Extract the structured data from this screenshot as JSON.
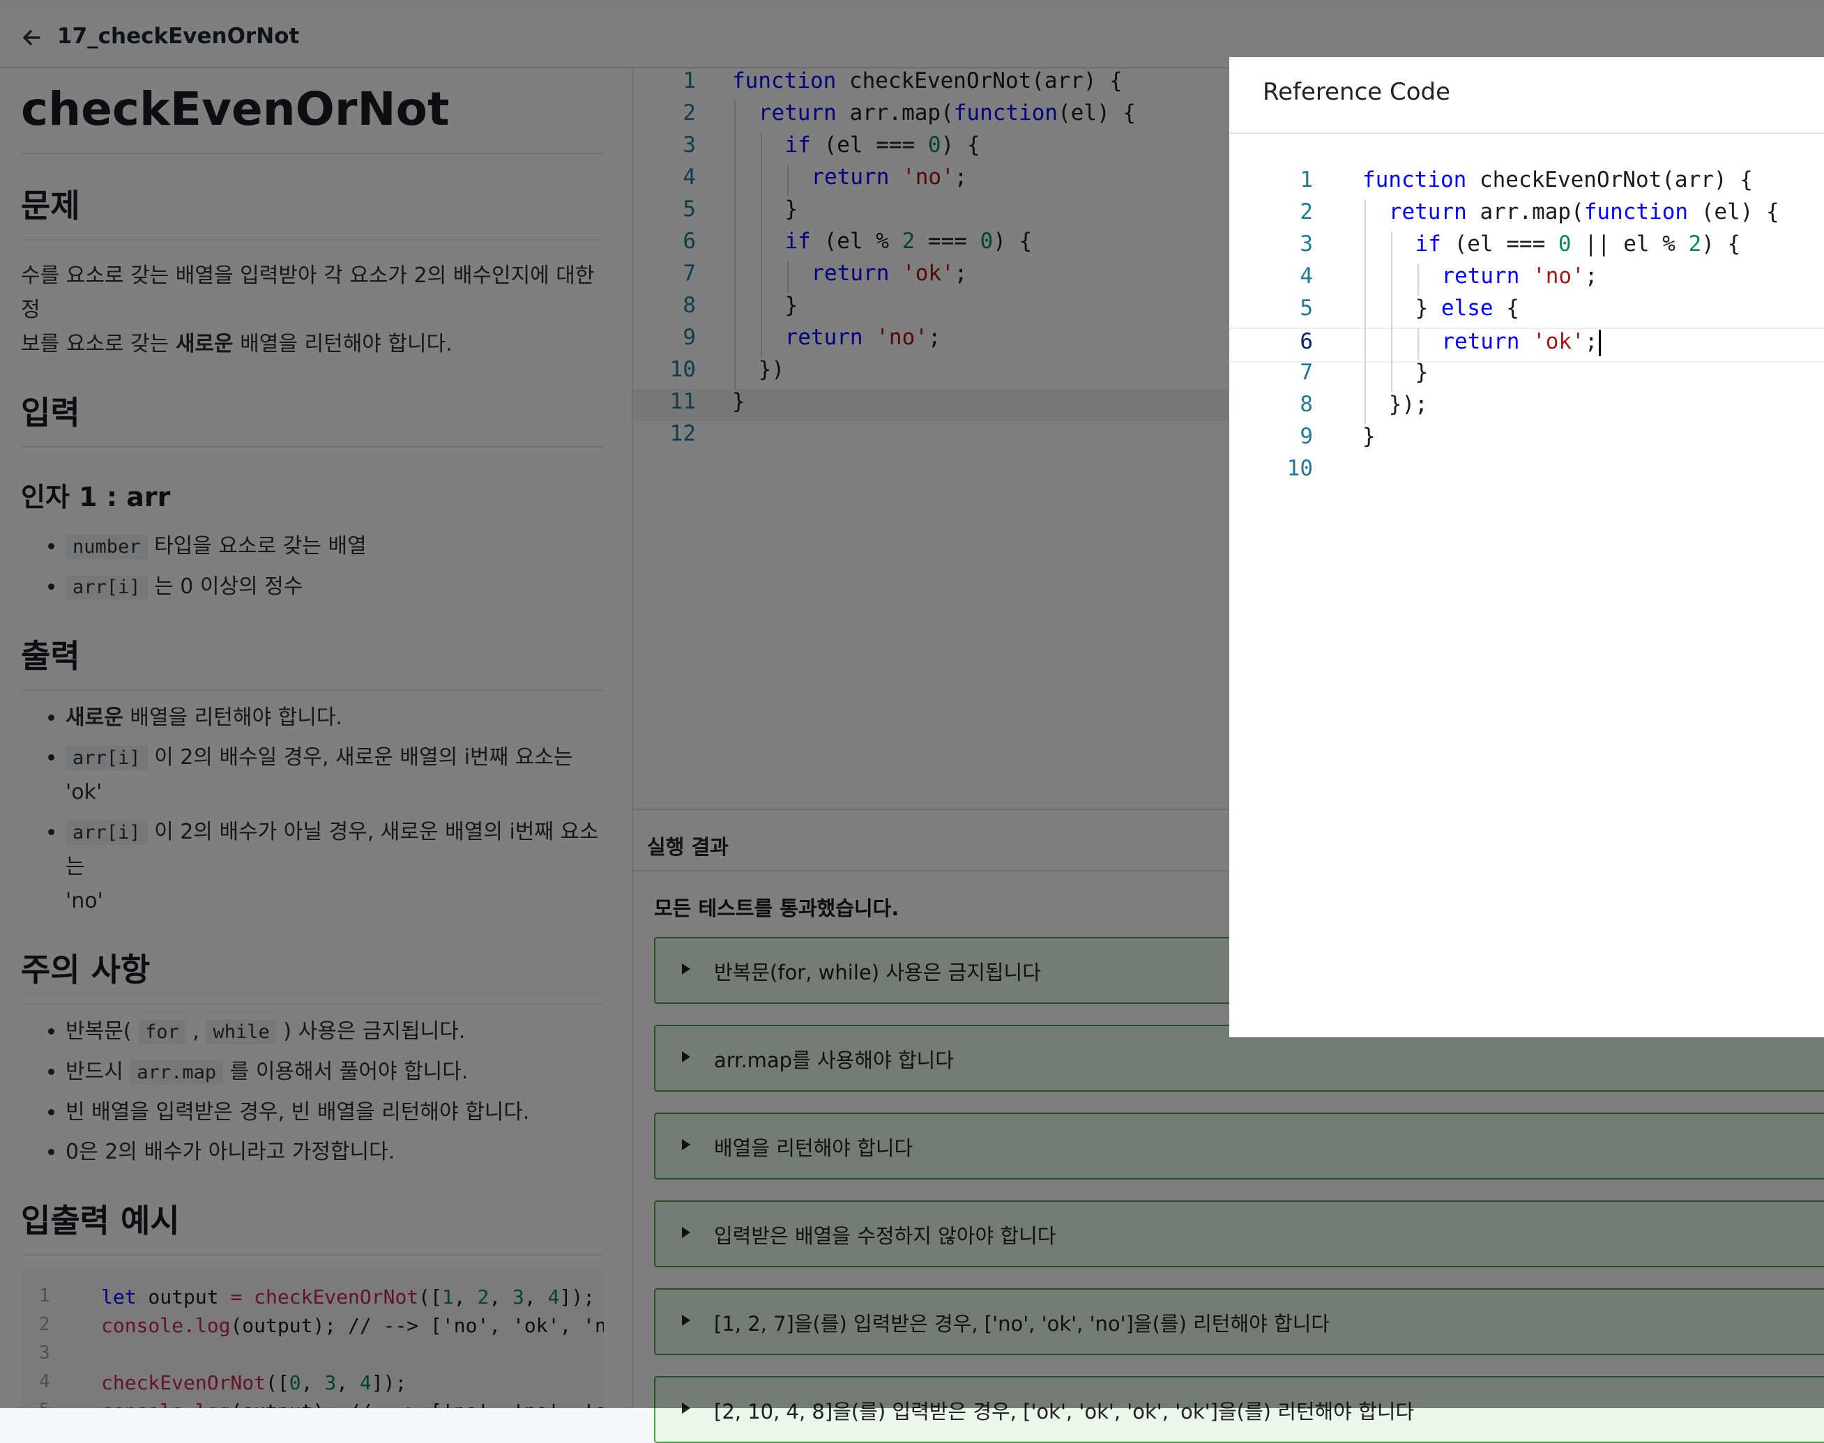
{
  "header": {
    "back_icon": "arrow-left-icon",
    "breadcrumb": "17_checkEvenOrNot"
  },
  "problem": {
    "title": "checkEvenOrNot",
    "section_problem": "문제",
    "problem_text_1": "수를 요소로 갖는 배열을 입력받아 각 요소가 2의 배수인지에 대한 정",
    "problem_text_2a": "보를 요소로 갖는 ",
    "problem_text_2b": "새로운",
    "problem_text_2c": " 배열을 리턴해야 합니다.",
    "section_input": "입력",
    "arg_heading": "인자 1 : arr",
    "input_items": [
      {
        "code": "number",
        "text": " 타입을 요소로 갖는 배열"
      },
      {
        "code": "arr[i]",
        "text": " 는 0 이상의 정수"
      }
    ],
    "section_output": "출력",
    "output_1a": "새로운",
    "output_1b": " 배열을 리턴해야 합니다.",
    "output_2_code": "arr[i]",
    "output_2_text": " 이 2의 배수일 경우, 새로운 배열의 i번째 요소는 'ok'",
    "output_3_code": "arr[i]",
    "output_3_text_1": " 이 2의 배수가 아닐 경우, 새로운 배열의 i번째 요소는",
    "output_3_text_2": "'no'",
    "section_notes": "주의 사항",
    "notes_1a": "반복문( ",
    "notes_1_code1": "for",
    "notes_1b": " , ",
    "notes_1_code2": "while",
    "notes_1c": " ) 사용은 금지됩니다.",
    "notes_2a": "반드시 ",
    "notes_2_code": "arr.map",
    "notes_2b": " 를 이용해서 풀어야 합니다.",
    "notes_3": "빈 배열을 입력받은 경우, 빈 배열을 리턴해야 합니다.",
    "notes_4": "0은 2의 배수가 아니라고 가정합니다.",
    "section_examples": "입출력 예시",
    "example_lines": [
      {
        "num": "1",
        "tokens": [
          [
            "kw",
            "let"
          ],
          [
            "fn",
            " output "
          ],
          [
            "pink",
            "="
          ],
          [
            "fn",
            " "
          ],
          [
            "pink",
            "checkEvenOrNot"
          ],
          [
            "fn",
            "(["
          ],
          [
            "num",
            "1"
          ],
          [
            "fn",
            ", "
          ],
          [
            "num",
            "2"
          ],
          [
            "fn",
            ", "
          ],
          [
            "num",
            "3"
          ],
          [
            "fn",
            ", "
          ],
          [
            "num",
            "4"
          ],
          [
            "fn",
            "]);"
          ]
        ]
      },
      {
        "num": "2",
        "tokens": [
          [
            "pink",
            "console.log"
          ],
          [
            "fn",
            "(output); "
          ],
          [
            "cm",
            "// --> ['no', 'ok', 'no'"
          ]
        ]
      },
      {
        "num": "3",
        "tokens": []
      },
      {
        "num": "4",
        "tokens": [
          [
            "pink",
            "checkEvenOrNot"
          ],
          [
            "fn",
            "(["
          ],
          [
            "num",
            "0"
          ],
          [
            "fn",
            ", "
          ],
          [
            "num",
            "3"
          ],
          [
            "fn",
            ", "
          ],
          [
            "num",
            "4"
          ],
          [
            "fn",
            "]);"
          ]
        ]
      },
      {
        "num": "5",
        "tokens": [
          [
            "pink",
            "console.log"
          ],
          [
            "fn",
            "(output); "
          ],
          [
            "cm",
            "// --> ['no', 'no', 'ok']"
          ]
        ]
      }
    ]
  },
  "editor": {
    "lines": [
      {
        "num": "1",
        "indent": 0,
        "tokens": [
          [
            "kw",
            "function"
          ],
          [
            "fn",
            " checkEvenOrNot(arr) {"
          ]
        ]
      },
      {
        "num": "2",
        "indent": 1,
        "tokens": [
          [
            "kw",
            "return"
          ],
          [
            "fn",
            " arr.map("
          ],
          [
            "kw",
            "function"
          ],
          [
            "fn",
            "(el) {"
          ]
        ]
      },
      {
        "num": "3",
        "indent": 2,
        "tokens": [
          [
            "kw",
            "if"
          ],
          [
            "fn",
            " (el === "
          ],
          [
            "num",
            "0"
          ],
          [
            "fn",
            ") {"
          ]
        ]
      },
      {
        "num": "4",
        "indent": 3,
        "tokens": [
          [
            "kw",
            "return"
          ],
          [
            "fn",
            " "
          ],
          [
            "str",
            "'no'"
          ],
          [
            "fn",
            ";"
          ]
        ]
      },
      {
        "num": "5",
        "indent": 2,
        "tokens": [
          [
            "fn",
            "}"
          ]
        ]
      },
      {
        "num": "6",
        "indent": 2,
        "tokens": [
          [
            "kw",
            "if"
          ],
          [
            "fn",
            " (el % "
          ],
          [
            "num",
            "2"
          ],
          [
            "fn",
            " === "
          ],
          [
            "num",
            "0"
          ],
          [
            "fn",
            ") {"
          ]
        ]
      },
      {
        "num": "7",
        "indent": 3,
        "tokens": [
          [
            "kw",
            "return"
          ],
          [
            "fn",
            " "
          ],
          [
            "str",
            "'ok'"
          ],
          [
            "fn",
            ";"
          ]
        ]
      },
      {
        "num": "8",
        "indent": 2,
        "tokens": [
          [
            "fn",
            "}"
          ]
        ]
      },
      {
        "num": "9",
        "indent": 2,
        "tokens": [
          [
            "kw",
            "return"
          ],
          [
            "fn",
            " "
          ],
          [
            "str",
            "'no'"
          ],
          [
            "fn",
            ";"
          ]
        ]
      },
      {
        "num": "10",
        "indent": 1,
        "tokens": [
          [
            "fn",
            "})"
          ]
        ]
      },
      {
        "num": "11",
        "indent": 0,
        "tokens": [
          [
            "fn",
            "}"
          ]
        ]
      },
      {
        "num": "12",
        "indent": 0,
        "tokens": []
      }
    ],
    "current_line": "11"
  },
  "results": {
    "header": "실행 결과",
    "summary": "모든 테스트를 통과했습니다.",
    "tests": [
      "반복문(for, while) 사용은 금지됩니다",
      "arr.map를 사용해야 합니다",
      "배열을 리턴해야 합니다",
      "입력받은 배열을 수정하지 않아야 합니다",
      "[1, 2, 7]을(를) 입력받은 경우, ['no', 'ok', 'no']을(를) 리턴해야 합니다",
      "[2, 10, 4, 8]을(를) 입력받은 경우, ['ok', 'ok', 'ok', 'ok']을(를) 리턴해야 합니다"
    ],
    "status_color": "#47a547"
  },
  "modal": {
    "title": "Reference Code",
    "lines": [
      {
        "num": "1",
        "indent": 0,
        "tokens": [
          [
            "kw",
            "function"
          ],
          [
            "fn",
            " checkEvenOrNot(arr) {"
          ]
        ]
      },
      {
        "num": "2",
        "indent": 1,
        "tokens": [
          [
            "kw",
            "return"
          ],
          [
            "fn",
            " arr.map("
          ],
          [
            "kw",
            "function"
          ],
          [
            "fn",
            " (el) {"
          ]
        ]
      },
      {
        "num": "3",
        "indent": 2,
        "tokens": [
          [
            "kw",
            "if"
          ],
          [
            "fn",
            " (el === "
          ],
          [
            "num",
            "0"
          ],
          [
            "fn",
            " || el % "
          ],
          [
            "num",
            "2"
          ],
          [
            "fn",
            ") {"
          ]
        ]
      },
      {
        "num": "4",
        "indent": 3,
        "tokens": [
          [
            "kw",
            "return"
          ],
          [
            "fn",
            " "
          ],
          [
            "str",
            "'no'"
          ],
          [
            "fn",
            ";"
          ]
        ]
      },
      {
        "num": "5",
        "indent": 2,
        "tokens": [
          [
            "fn",
            "} "
          ],
          [
            "kw",
            "else"
          ],
          [
            "fn",
            " {"
          ]
        ]
      },
      {
        "num": "6",
        "indent": 3,
        "tokens": [
          [
            "kw",
            "return"
          ],
          [
            "fn",
            " "
          ],
          [
            "str",
            "'ok'"
          ],
          [
            "fn",
            ";"
          ]
        ]
      },
      {
        "num": "7",
        "indent": 2,
        "tokens": [
          [
            "fn",
            "}"
          ]
        ]
      },
      {
        "num": "8",
        "indent": 1,
        "tokens": [
          [
            "fn",
            "});"
          ]
        ]
      },
      {
        "num": "9",
        "indent": 0,
        "tokens": [
          [
            "fn",
            "}"
          ]
        ]
      },
      {
        "num": "10",
        "indent": 0,
        "tokens": []
      }
    ],
    "current_line": "6"
  }
}
